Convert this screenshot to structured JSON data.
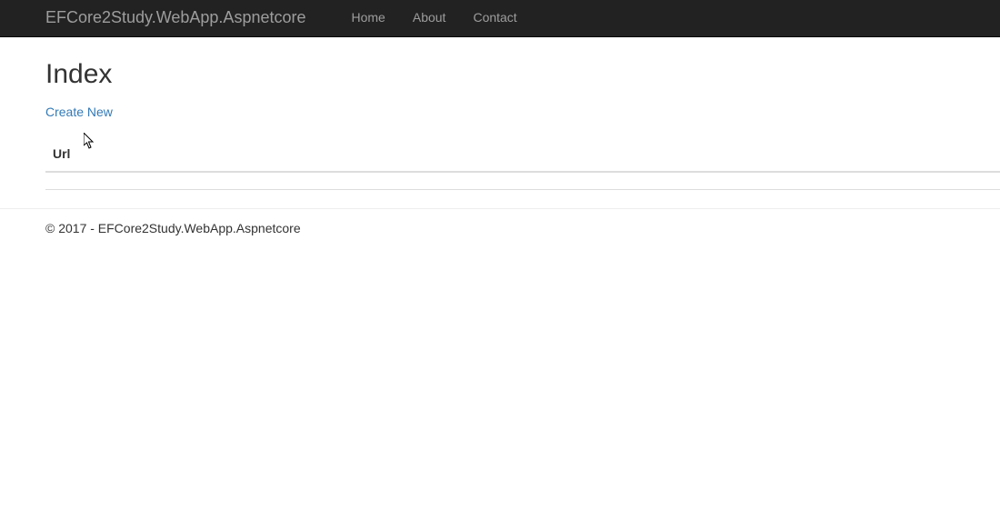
{
  "navbar": {
    "brand": "EFCore2Study.WebApp.Aspnetcore",
    "links": {
      "home": "Home",
      "about": "About",
      "contact": "Contact"
    }
  },
  "page": {
    "title": "Index",
    "create_link": "Create New"
  },
  "table": {
    "headers": {
      "url": "Url"
    }
  },
  "footer": {
    "text": "© 2017 - EFCore2Study.WebApp.Aspnetcore"
  }
}
